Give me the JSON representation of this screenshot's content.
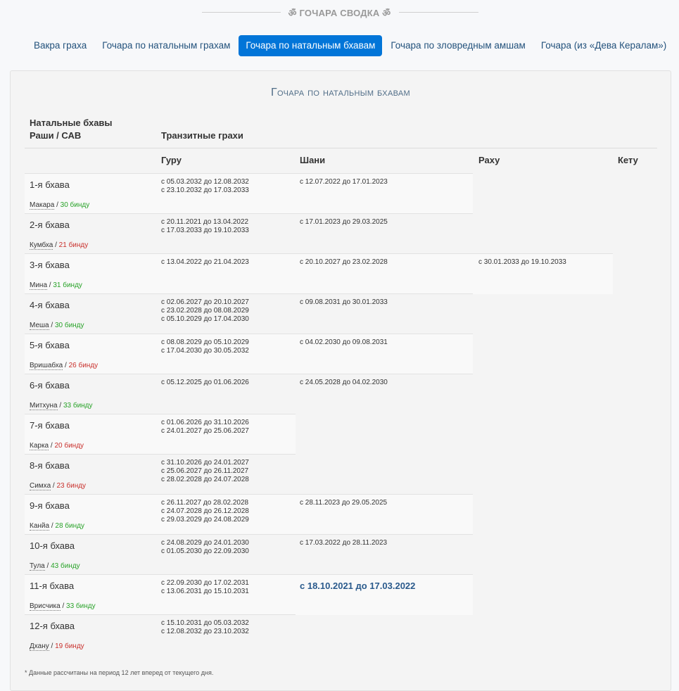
{
  "header": {
    "title": "ॐ ГОЧАРА СВОДКА ॐ"
  },
  "tabs": [
    {
      "label": "Вакра граха",
      "active": false
    },
    {
      "label": "Гочара по натальным грахам",
      "active": false
    },
    {
      "label": "Гочара по натальным бхавам",
      "active": true
    },
    {
      "label": "Гочара по зловредным амшам",
      "active": false
    },
    {
      "label": "Гочара (из «Дева Кералам»)",
      "active": false
    }
  ],
  "panel": {
    "title": "Гочара по натальным бхавам",
    "col_bhava_line1": "Натальные бхавы",
    "col_bhava_line2": "Раши / САВ",
    "col_transit": "Транзитные грахи",
    "planets": [
      "Гуру",
      "Шани",
      "Раху",
      "Кету"
    ],
    "footnote": "* Данные рассчитаны на период 12 лет вперед от текущего дня."
  },
  "rows": [
    {
      "bhava": "1-я бхава",
      "rashi": "Макара",
      "bindu": "30 бинду",
      "good": true,
      "guru": "с 05.03.2032 до 12.08.2032\nс 23.10.2032 до 17.03.2033",
      "shani": "с 12.07.2022 до 17.01.2023",
      "rahu": ""
    },
    {
      "bhava": "2-я бхава",
      "rashi": "Кумбха",
      "bindu": "21 бинду",
      "good": false,
      "guru": "с 20.11.2021 до 13.04.2022\nс 17.03.2033 до 19.10.2033",
      "shani": "с 17.01.2023 до 29.03.2025",
      "rahu": ""
    },
    {
      "bhava": "3-я бхава",
      "rashi": "Мина",
      "bindu": "31 бинду",
      "good": true,
      "guru": "с 13.04.2022 до 21.04.2023",
      "shani": "с 20.10.2027 до 23.02.2028",
      "rahu": "с 30.01.2033 до 19.10.2033"
    },
    {
      "bhava": "4-я бхава",
      "rashi": "Меша",
      "bindu": "30 бинду",
      "good": true,
      "guru": "с 02.06.2027 до 20.10.2027\nс 23.02.2028 до 08.08.2029\nс 05.10.2029 до 17.04.2030",
      "shani": "с 09.08.2031 до 30.01.2033",
      "rahu": ""
    },
    {
      "bhava": "5-я бхава",
      "rashi": "Вришабха",
      "bindu": "26 бинду",
      "good": false,
      "guru": "с 08.08.2029 до 05.10.2029\nс 17.04.2030 до 30.05.2032",
      "shani": "с 04.02.2030 до 09.08.2031",
      "rahu": ""
    },
    {
      "bhava": "6-я бхава",
      "rashi": "Митхуна",
      "bindu": "33 бинду",
      "good": true,
      "guru": "с 05.12.2025 до 01.06.2026",
      "shani": "с 24.05.2028 до 04.02.2030",
      "rahu": ""
    },
    {
      "bhava": "7-я бхава",
      "rashi": "Карка",
      "bindu": "20 бинду",
      "good": false,
      "guru": "с 01.06.2026 до 31.10.2026\nс 24.01.2027 до 25.06.2027",
      "shani": "",
      "rahu": ""
    },
    {
      "bhava": "8-я бхава",
      "rashi": "Симха",
      "bindu": "23 бинду",
      "good": false,
      "guru": "с 31.10.2026 до 24.01.2027\nс 25.06.2027 до 26.11.2027\nс 28.02.2028 до 24.07.2028",
      "shani": "",
      "rahu": ""
    },
    {
      "bhava": "9-я бхава",
      "rashi": "Канйа",
      "bindu": "28 бинду",
      "good": true,
      "guru": "с 26.11.2027 до 28.02.2028\nс 24.07.2028 до 26.12.2028\nс 29.03.2029 до 24.08.2029",
      "shani": "с 28.11.2023 до 29.05.2025",
      "rahu": ""
    },
    {
      "bhava": "10-я бхава",
      "rashi": "Тула",
      "bindu": "43 бинду",
      "good": true,
      "guru": "с 24.08.2029 до 24.01.2030\nс 01.05.2030 до 22.09.2030",
      "shani": "с 17.03.2022 до 28.11.2023",
      "rahu": ""
    },
    {
      "bhava": "11-я бхава",
      "rashi": "Врисчика",
      "bindu": "33 бинду",
      "good": true,
      "guru": "с 22.09.2030 до 17.02.2031\nс 13.06.2031 до 15.10.2031",
      "shani": "с 18.10.2021 до 17.03.2022",
      "shani_current": true,
      "rahu": ""
    },
    {
      "bhava": "12-я бхава",
      "rashi": "Дхану",
      "bindu": "19 бинду",
      "good": false,
      "guru": "с 15.10.2031 до 05.03.2032\nс 12.08.2032 до 23.10.2032",
      "shani": "",
      "rahu": ""
    }
  ]
}
